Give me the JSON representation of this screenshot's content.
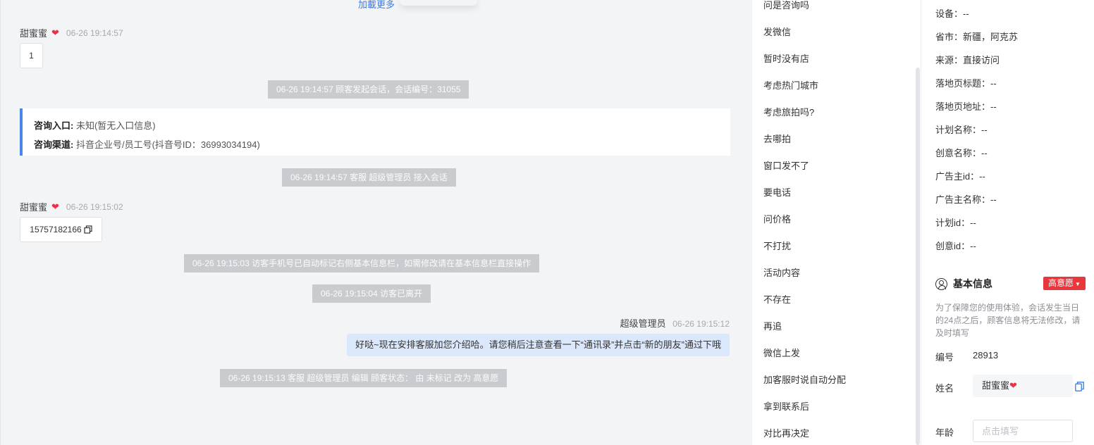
{
  "chat": {
    "load_more": "加載更多",
    "messages": [
      {
        "sender": "甜蜜蜜",
        "heart": "❤",
        "time": "06-26 19:14:57",
        "text": "1"
      },
      {
        "sender": "甜蜜蜜",
        "heart": "❤",
        "time": "06-26 19:15:02",
        "text": "15757182166"
      }
    ],
    "system_events": [
      "06-26 19:14:57 顾客发起会话，会话编号：31055",
      "06-26 19:14:57 客服 超级管理员 接入会话",
      "06-26 19:15:03 访客手机号已自动标记右侧基本信息栏，如需修改请在基本信息栏直接操作",
      "06-26 19:15:04 访客已离开",
      "06-26 19:15:13 客服 超级管理员 编辑 顾客状态： 由 未标记 改为 高意愿"
    ],
    "info_card": {
      "entry_label": "咨询入口:",
      "entry_value": "未知(暂无入口信息)",
      "channel_label": "咨询渠道:",
      "channel_value": "抖音企业号/员工号(抖音号ID：36993034194)"
    },
    "agent_reply": {
      "sender": "超级管理员",
      "time": "06-26 19:15:12",
      "text": "好哒~现在安排客服加您介绍哈。请您稍后注意查看一下“通讯录”并点击“新的朋友”通过下哦"
    }
  },
  "quick_phrases": [
    "问是咨询吗",
    "发微信",
    "暂时没有店",
    "考虑热门城市",
    "考虑旅拍吗?",
    "去哪拍",
    "窗口发不了",
    "要电话",
    "问价格",
    "不打扰",
    "活动内容",
    "不存在",
    "再追",
    "微信上发",
    "加客服时说自动分配",
    "拿到联系后",
    "对比再决定"
  ],
  "visitor_info": [
    {
      "label": "设备：",
      "value": "--"
    },
    {
      "label": "省市：",
      "value": "新疆，阿克苏"
    },
    {
      "label": "来源：",
      "value": "直接访问"
    },
    {
      "label": "落地页标题：",
      "value": "--"
    },
    {
      "label": "落地页地址：",
      "value": "--"
    },
    {
      "label": "计划名称：",
      "value": "--"
    },
    {
      "label": "创意名称：",
      "value": "--"
    },
    {
      "label": "广告主id：",
      "value": "--"
    },
    {
      "label": "广告主名称：",
      "value": "--"
    },
    {
      "label": "计划id：",
      "value": "--"
    },
    {
      "label": "创意id：",
      "value": "--"
    }
  ],
  "basic_info": {
    "title": "基本信息",
    "intent_badge": "高意愿",
    "notice": "为了保障您的使用体验，会话发生当日的24点之后，顾客信息将无法修改，请及时填写",
    "id_label": "编号",
    "id_value": "28913",
    "name_label": "姓名",
    "name_value": "甜蜜蜜",
    "name_heart": "❤",
    "age_label": "年龄",
    "age_placeholder": "点击填写"
  },
  "colors": {
    "accent_blue": "#4a86e8",
    "link_blue": "#3a7ce4",
    "badge_red": "#e8383d",
    "heart_red": "#e8314a",
    "system_gray": "#c9cbcf",
    "outgoing_bubble": "#dbe7fb"
  }
}
